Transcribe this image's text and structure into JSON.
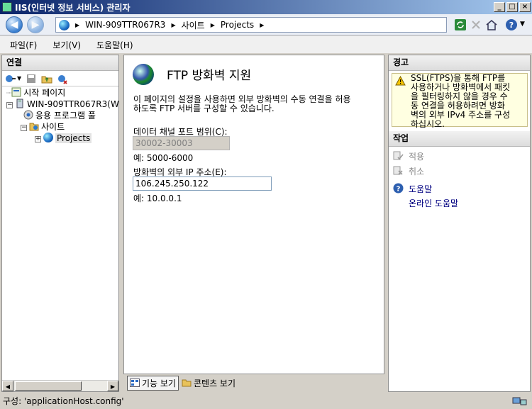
{
  "window": {
    "title": "IIS(인터넷 정보 서비스) 관리자"
  },
  "address": {
    "crumbs": [
      "WIN-909TTR067R3",
      "사이트",
      "Projects"
    ]
  },
  "menu": [
    "파일(F)",
    "보기(V)",
    "도움말(H)"
  ],
  "connections": {
    "header": "연결",
    "tree": [
      {
        "label": "시작 페이지"
      },
      {
        "label": "WIN-909TTR067R3(W"
      },
      {
        "label": "응용 프로그램 풀"
      },
      {
        "label": "사이트"
      },
      {
        "label": "Projects"
      }
    ]
  },
  "feature": {
    "title": "FTP 방화벽 지원",
    "description_lines": [
      "이 페이지의 설정을 사용하면 외부 방화벽의 수동 연결을 허용",
      "하도록 FTP 서버를 구성할 수 있습니다."
    ],
    "port_range": {
      "label": "데이터 채널 포트 범위(C):",
      "value": "30002-30003",
      "example": "예: 5000-6000"
    },
    "external_ip": {
      "label": "방화벽의 외부 IP 주소(E):",
      "value": "106.245.250.122",
      "example": "예: 10.0.0.1"
    },
    "bottom_tabs": [
      "기능 보기",
      "콘텐츠 보기"
    ]
  },
  "alerts": {
    "header": "경고",
    "message_lines": [
      "SSL(FTPS)을 통해 FTP를",
      "사용하거나 방화벽에서 패킷",
      "을 필터링하지 않을 경우 수",
      "동 연결을 허용하려면 방화",
      "벽의 외부 IPv4 주소를 구성",
      "하십시오."
    ]
  },
  "actions": {
    "header": "작업",
    "apply": "적용",
    "cancel": "취소",
    "help": "도움말",
    "online_help": "온라인 도움말"
  },
  "status": {
    "text": "구성: 'applicationHost.config'"
  }
}
